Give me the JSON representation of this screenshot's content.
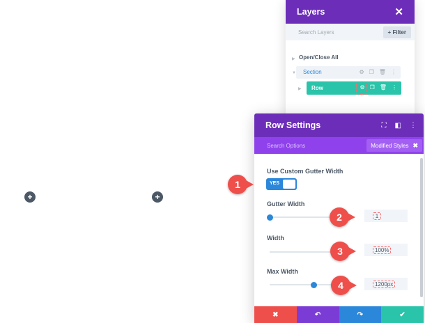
{
  "canvas": {
    "add_left": "+",
    "add_mid": "+"
  },
  "layers": {
    "title": "Layers",
    "close": "✕",
    "search_placeholder": "Search Layers",
    "filter_label": "+ Filter",
    "open_close": "Open/Close All",
    "section_label": "Section",
    "row_label": "Row"
  },
  "modal": {
    "title": "Row Settings",
    "search_placeholder": "Search Options",
    "modified_styles": "Modified Styles",
    "modified_close": "✖",
    "custom_gutter_label": "Use Custom Gutter Width",
    "toggle_value": "YES",
    "gutter_label": "Gutter Width",
    "gutter_value": "1",
    "gutter_level": 0.0,
    "width_label": "Width",
    "width_value": "100%",
    "width_level": 1.0,
    "max_width_label": "Max Width",
    "max_width_value": "1200px",
    "max_width_level": 0.55
  },
  "footer": {
    "cancel": "✖",
    "undo": "↶",
    "redo": "↷",
    "save": "✔",
    "colors": [
      "#ef4f4b",
      "#7b3cd6",
      "#2b87da",
      "#29c4a9"
    ]
  },
  "badges": [
    "1",
    "2",
    "3",
    "4"
  ],
  "icons": {
    "header": [
      "fullscreen-icon",
      "split-view-icon",
      "more-icon"
    ],
    "layer_row": [
      "gear-icon",
      "duplicate-icon",
      "trash-icon",
      "more-icon"
    ]
  }
}
